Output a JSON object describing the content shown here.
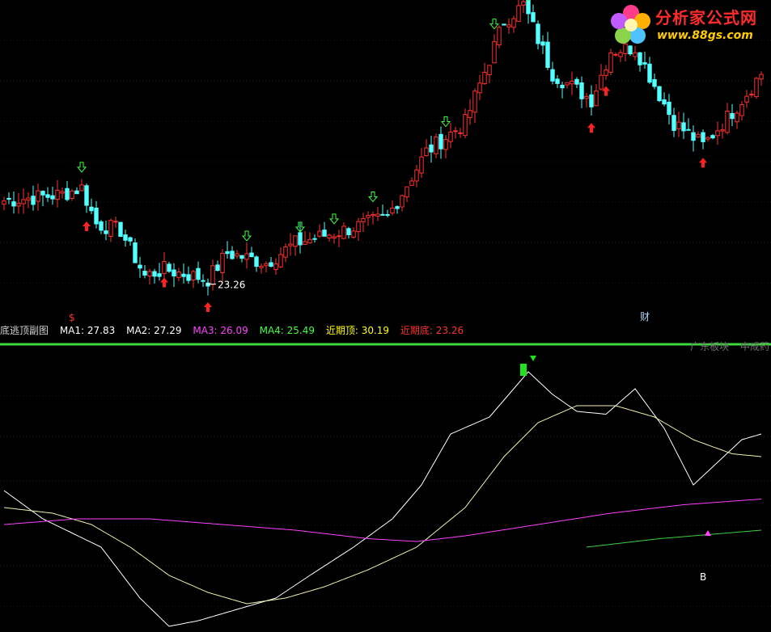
{
  "logo": {
    "title": "分析家公式网",
    "url": "www.88gs.com"
  },
  "legend": {
    "name": "底逃顶副图",
    "ma1": "MA1: 27.83",
    "ma2": "MA2: 27.29",
    "ma3": "MA3: 26.09",
    "ma4": "MA4: 25.49",
    "recent_top": "近期顶: 30.19",
    "recent_bottom": "近期底: 23.26"
  },
  "top_right_labels": [
    "广东板块",
    "中成药"
  ],
  "colors": {
    "background": "#000000",
    "up_candle": "#ff3030",
    "down_candle": "#54ffff",
    "separator": "#3cd83c",
    "white_line": "#ffffff",
    "yellow_line": "#f0f0b0",
    "magenta_line": "#ff40ff",
    "green_line": "#40d040",
    "ma1_color": "#ffffff",
    "ma2_color": "#ffffff",
    "ma3_color": "#ff40ff",
    "ma4_color": "#40ff40",
    "top_color": "#ffff00",
    "bottom_color": "#ff3030"
  },
  "chart_data": [
    {
      "type": "candlestick",
      "panel": "price",
      "ylim": [
        22.2,
        32.0
      ],
      "low_annotation": {
        "index": 42,
        "text": "23.26"
      },
      "markers": [
        {
          "index": 17,
          "kind": "buy",
          "label": ""
        },
        {
          "index": 33,
          "kind": "buy",
          "label": ""
        },
        {
          "index": 42,
          "kind": "buy",
          "label": ""
        },
        {
          "index": 121,
          "kind": "buy",
          "label": ""
        },
        {
          "index": 124,
          "kind": "buy",
          "label": ""
        },
        {
          "index": 144,
          "kind": "buy",
          "label": ""
        },
        {
          "index": 14,
          "kind": "dollar",
          "label": "$"
        },
        {
          "index": 16,
          "kind": "sell",
          "label": ""
        },
        {
          "index": 50,
          "kind": "sell",
          "label": ""
        },
        {
          "index": 61,
          "kind": "sell",
          "label": ""
        },
        {
          "index": 68,
          "kind": "sell",
          "label": ""
        },
        {
          "index": 76,
          "kind": "sell",
          "label": ""
        },
        {
          "index": 91,
          "kind": "sell",
          "label": ""
        },
        {
          "index": 101,
          "kind": "sell",
          "label": ""
        },
        {
          "index": 108,
          "kind": "sell",
          "label": ""
        },
        {
          "index": 132,
          "kind": "caption",
          "label": "财"
        }
      ],
      "anchors": [
        [
          0,
          25.9
        ],
        [
          6,
          26.0
        ],
        [
          12,
          26.1
        ],
        [
          16,
          26.3
        ],
        [
          19,
          25.2
        ],
        [
          24,
          25.0
        ],
        [
          29,
          23.6
        ],
        [
          33,
          23.8
        ],
        [
          42,
          23.5
        ],
        [
          46,
          24.3
        ],
        [
          54,
          24.0
        ],
        [
          60,
          24.6
        ],
        [
          70,
          25.0
        ],
        [
          79,
          25.4
        ],
        [
          87,
          27.4
        ],
        [
          95,
          28.3
        ],
        [
          103,
          31.4
        ],
        [
          107,
          31.9
        ],
        [
          113,
          29.8
        ],
        [
          121,
          29.0
        ],
        [
          125,
          30.5
        ],
        [
          130,
          30.6
        ],
        [
          138,
          28.3
        ],
        [
          144,
          27.6
        ],
        [
          151,
          28.8
        ],
        [
          156,
          29.8
        ]
      ]
    },
    {
      "type": "line",
      "panel": "indicator",
      "xlim": [
        0,
        156
      ],
      "series": [
        {
          "color": "white",
          "points": [
            [
              0,
              0.5
            ],
            [
              8,
              0.4
            ],
            [
              20,
              0.3
            ],
            [
              28,
              0.12
            ],
            [
              34,
              0.02
            ],
            [
              40,
              0.04
            ],
            [
              48,
              0.08
            ],
            [
              56,
              0.12
            ],
            [
              63,
              0.2
            ],
            [
              72,
              0.3
            ],
            [
              80,
              0.4
            ],
            [
              86,
              0.52
            ],
            [
              92,
              0.7
            ],
            [
              100,
              0.76
            ],
            [
              108,
              0.92
            ],
            [
              113,
              0.84
            ],
            [
              118,
              0.78
            ],
            [
              124,
              0.77
            ],
            [
              130,
              0.86
            ],
            [
              136,
              0.72
            ],
            [
              142,
              0.52
            ],
            [
              147,
              0.6
            ],
            [
              152,
              0.68
            ],
            [
              156,
              0.7
            ]
          ]
        },
        {
          "color": "yellow",
          "points": [
            [
              0,
              0.44
            ],
            [
              10,
              0.42
            ],
            [
              18,
              0.38
            ],
            [
              26,
              0.3
            ],
            [
              34,
              0.2
            ],
            [
              42,
              0.14
            ],
            [
              50,
              0.1
            ],
            [
              58,
              0.12
            ],
            [
              66,
              0.16
            ],
            [
              75,
              0.22
            ],
            [
              85,
              0.3
            ],
            [
              95,
              0.44
            ],
            [
              103,
              0.62
            ],
            [
              110,
              0.74
            ],
            [
              118,
              0.8
            ],
            [
              126,
              0.8
            ],
            [
              134,
              0.76
            ],
            [
              142,
              0.68
            ],
            [
              150,
              0.63
            ],
            [
              156,
              0.62
            ]
          ]
        },
        {
          "color": "magenta",
          "points": [
            [
              0,
              0.38
            ],
            [
              15,
              0.4
            ],
            [
              30,
              0.4
            ],
            [
              45,
              0.38
            ],
            [
              60,
              0.36
            ],
            [
              75,
              0.33
            ],
            [
              85,
              0.32
            ],
            [
              95,
              0.34
            ],
            [
              110,
              0.38
            ],
            [
              125,
              0.42
            ],
            [
              140,
              0.45
            ],
            [
              156,
              0.47
            ]
          ]
        },
        {
          "color": "green",
          "points": [
            [
              120,
              0.3
            ],
            [
              135,
              0.33
            ],
            [
              156,
              0.36
            ]
          ]
        }
      ],
      "markers": [
        {
          "index": 107,
          "kind": "top-bar",
          "label": ""
        },
        {
          "index": 109,
          "kind": "down-triangle",
          "label": ""
        },
        {
          "index": 145,
          "kind": "up-triangle",
          "label": ""
        },
        {
          "index": 144,
          "kind": "text",
          "label": "B"
        }
      ]
    }
  ]
}
